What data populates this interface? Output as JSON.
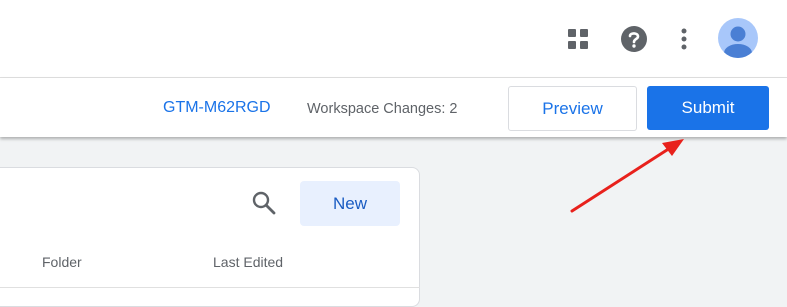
{
  "header": {
    "icons": [
      "apps-grid-icon",
      "help-icon",
      "more-vert-icon",
      "account-avatar-icon"
    ]
  },
  "toolbar": {
    "container_id": "GTM-M62RGD",
    "workspace_changes": "Workspace Changes: 2",
    "preview_label": "Preview",
    "submit_label": "Submit"
  },
  "panel": {
    "new_label": "New",
    "columns": [
      "Folder",
      "Last Edited"
    ]
  },
  "colors": {
    "accent": "#1a73e8",
    "annotation": "#e8211c"
  }
}
